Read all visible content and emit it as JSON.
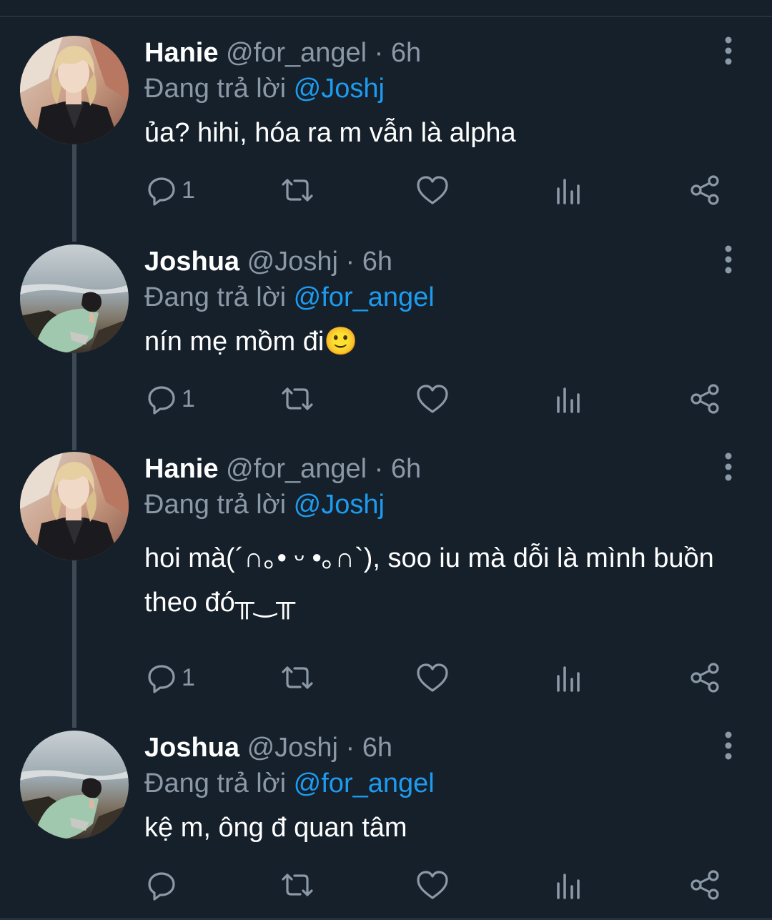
{
  "tweets": [
    {
      "name": "Hanie",
      "handle": "@for_angel",
      "time": "6h",
      "reply_prefix": "Đang trả lời",
      "reply_to": "@Joshj",
      "text": "ủa? hihi, hóa ra m vẫn là alpha",
      "text_line2": "",
      "reply_count": "1",
      "avatar": "portrait-blonde"
    },
    {
      "name": "Joshua",
      "handle": "@Joshj",
      "time": "6h",
      "reply_prefix": "Đang trả lời",
      "reply_to": "@for_angel",
      "text": "nín mẹ mồm đi🙂",
      "text_line2": "",
      "reply_count": "1",
      "avatar": "beach-photo"
    },
    {
      "name": "Hanie",
      "handle": "@for_angel",
      "time": "6h",
      "reply_prefix": "Đang trả lời",
      "reply_to": "@Joshj",
      "text": "hoi mà(´∩｡• ᵕ •｡∩`), soo iu mà dỗi là mình buồn",
      "text_line2": "theo đó╥‿╥",
      "reply_count": "1",
      "avatar": "portrait-blonde"
    },
    {
      "name": "Joshua",
      "handle": "@Joshj",
      "time": "6h",
      "reply_prefix": "Đang trả lời",
      "reply_to": "@for_angel",
      "text": "kệ m, ông đ quan tâm",
      "text_line2": "",
      "reply_count": "",
      "avatar": "beach-photo"
    }
  ],
  "separator": "·",
  "icons": [
    "reply-icon",
    "retweet-icon",
    "like-icon",
    "views-icon",
    "share-icon",
    "more-icon"
  ],
  "colors": {
    "background": "#15202b",
    "mention": "#1d9bf0",
    "muted": "#8b98a5",
    "thread_line": "#3d4a56"
  }
}
